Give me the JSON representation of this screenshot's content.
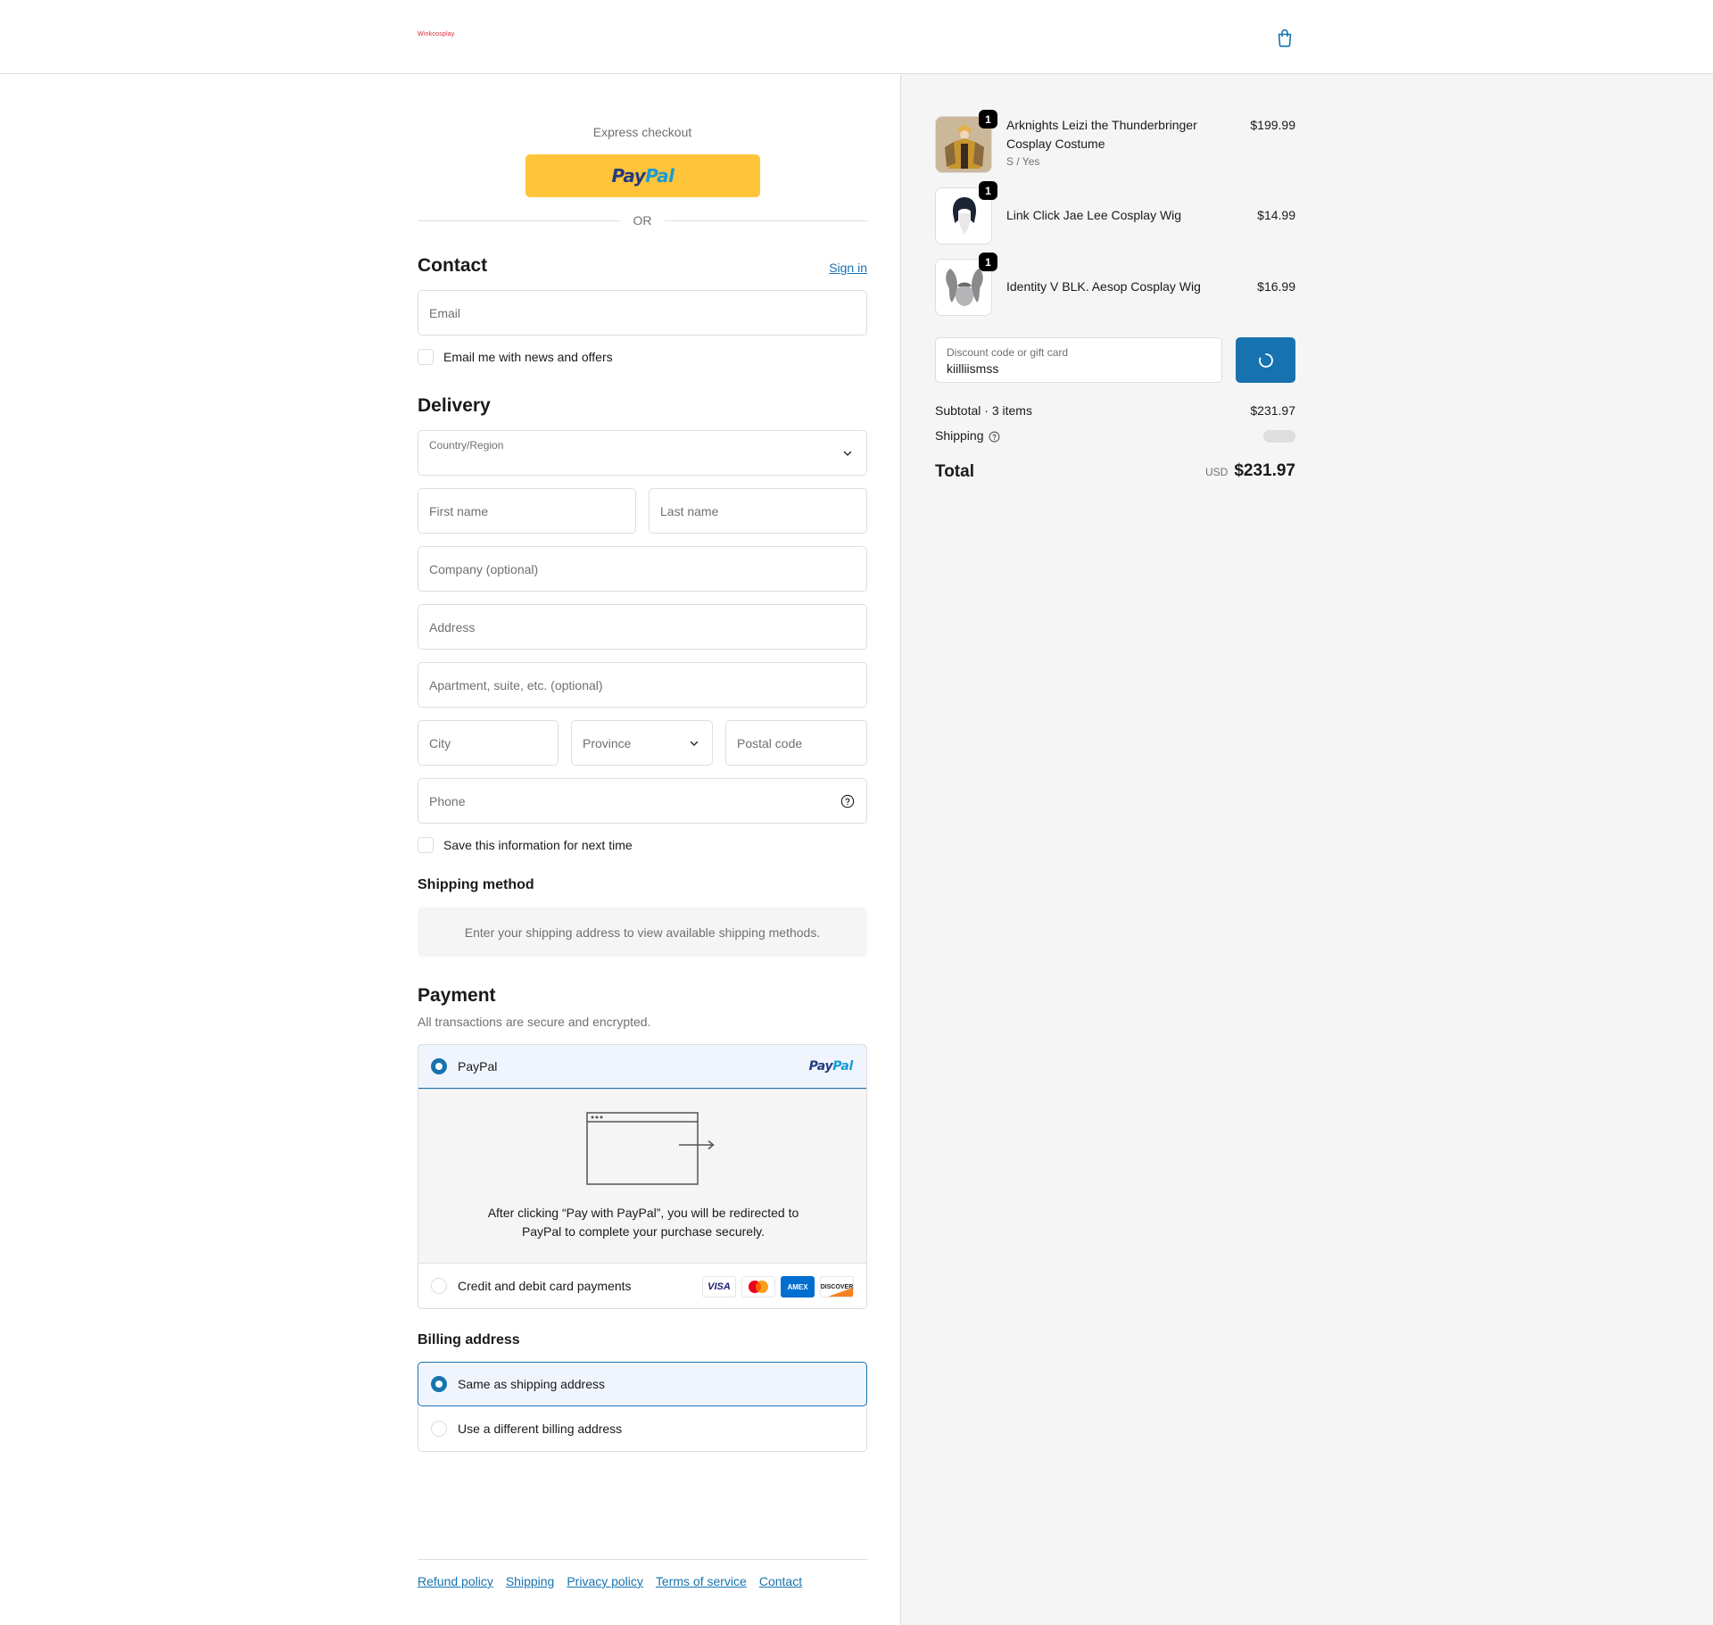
{
  "header": {
    "logo": "Winkcosplay"
  },
  "express": {
    "label": "Express checkout",
    "paypal_part1": "Pay",
    "paypal_part2": "Pal",
    "or": "OR"
  },
  "contact": {
    "title": "Contact",
    "sign_in": "Sign in",
    "email_placeholder": "Email",
    "newsletter_label": "Email me with news and offers"
  },
  "delivery": {
    "title": "Delivery",
    "country_label": "Country/Region",
    "first_name": "First name",
    "last_name": "Last name",
    "company": "Company (optional)",
    "address": "Address",
    "apartment": "Apartment, suite, etc. (optional)",
    "city": "City",
    "province": "Province",
    "postal": "Postal code",
    "phone": "Phone",
    "save_label": "Save this information for next time"
  },
  "shipping_method": {
    "title": "Shipping method",
    "note": "Enter your shipping address to view available shipping methods."
  },
  "payment": {
    "title": "Payment",
    "subtitle": "All transactions are secure and encrypted.",
    "paypal_option": "PayPal",
    "paypal_logo_1": "Pay",
    "paypal_logo_2": "Pal",
    "redirect_text": "After clicking “Pay with PayPal”, you will be redirected to PayPal to complete your purchase securely.",
    "card_option": "Credit and debit card payments",
    "card_brands": [
      "VISA",
      "Mastercard",
      "AMEX",
      "DISCOVER"
    ],
    "selected": "paypal"
  },
  "billing": {
    "title": "Billing address",
    "same": "Same as shipping address",
    "different": "Use a different billing address",
    "selected": "same"
  },
  "footer": {
    "links": [
      "Refund policy",
      "Shipping",
      "Privacy policy",
      "Terms of service",
      "Contact"
    ]
  },
  "order": {
    "items": [
      {
        "name": "Arknights Leizi the Thunderbringer Cosplay Costume",
        "variant": "S / Yes",
        "qty": "1",
        "price": "$199.99"
      },
      {
        "name": "Link Click Jae Lee Cosplay Wig",
        "variant": "",
        "qty": "1",
        "price": "$14.99"
      },
      {
        "name": "Identity V BLK. Aesop Cosplay Wig",
        "variant": "",
        "qty": "1",
        "price": "$16.99"
      }
    ],
    "discount_label": "Discount code or gift card",
    "discount_value": "kiilliismss",
    "subtotal_label": "Subtotal · 3 items",
    "subtotal_value": "$231.97",
    "shipping_label": "Shipping",
    "total_label": "Total",
    "currency": "USD",
    "total_value": "$231.97"
  },
  "colors": {
    "accent": "#1773b0",
    "paypal_yellow": "#ffc439",
    "logo_red": "#d6252f"
  },
  "icons": [
    "shopping-bag-icon",
    "chevron-down-icon",
    "help-circle-icon",
    "spinner-icon",
    "browser-redirect-icon"
  ]
}
